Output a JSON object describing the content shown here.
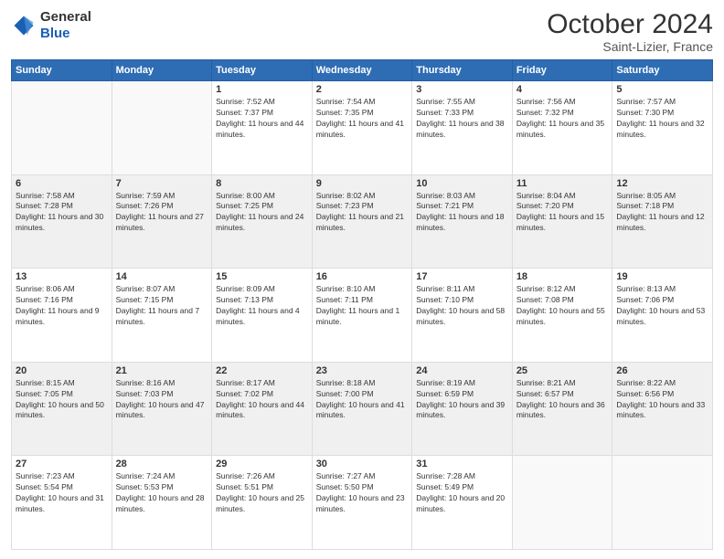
{
  "header": {
    "logo": {
      "general": "General",
      "blue": "Blue"
    },
    "month": "October 2024",
    "location": "Saint-Lizier, France"
  },
  "weekdays": [
    "Sunday",
    "Monday",
    "Tuesday",
    "Wednesday",
    "Thursday",
    "Friday",
    "Saturday"
  ],
  "weeks": [
    [
      {
        "day": "",
        "info": ""
      },
      {
        "day": "",
        "info": ""
      },
      {
        "day": "1",
        "info": "Sunrise: 7:52 AM\nSunset: 7:37 PM\nDaylight: 11 hours and 44 minutes."
      },
      {
        "day": "2",
        "info": "Sunrise: 7:54 AM\nSunset: 7:35 PM\nDaylight: 11 hours and 41 minutes."
      },
      {
        "day": "3",
        "info": "Sunrise: 7:55 AM\nSunset: 7:33 PM\nDaylight: 11 hours and 38 minutes."
      },
      {
        "day": "4",
        "info": "Sunrise: 7:56 AM\nSunset: 7:32 PM\nDaylight: 11 hours and 35 minutes."
      },
      {
        "day": "5",
        "info": "Sunrise: 7:57 AM\nSunset: 7:30 PM\nDaylight: 11 hours and 32 minutes."
      }
    ],
    [
      {
        "day": "6",
        "info": "Sunrise: 7:58 AM\nSunset: 7:28 PM\nDaylight: 11 hours and 30 minutes."
      },
      {
        "day": "7",
        "info": "Sunrise: 7:59 AM\nSunset: 7:26 PM\nDaylight: 11 hours and 27 minutes."
      },
      {
        "day": "8",
        "info": "Sunrise: 8:00 AM\nSunset: 7:25 PM\nDaylight: 11 hours and 24 minutes."
      },
      {
        "day": "9",
        "info": "Sunrise: 8:02 AM\nSunset: 7:23 PM\nDaylight: 11 hours and 21 minutes."
      },
      {
        "day": "10",
        "info": "Sunrise: 8:03 AM\nSunset: 7:21 PM\nDaylight: 11 hours and 18 minutes."
      },
      {
        "day": "11",
        "info": "Sunrise: 8:04 AM\nSunset: 7:20 PM\nDaylight: 11 hours and 15 minutes."
      },
      {
        "day": "12",
        "info": "Sunrise: 8:05 AM\nSunset: 7:18 PM\nDaylight: 11 hours and 12 minutes."
      }
    ],
    [
      {
        "day": "13",
        "info": "Sunrise: 8:06 AM\nSunset: 7:16 PM\nDaylight: 11 hours and 9 minutes."
      },
      {
        "day": "14",
        "info": "Sunrise: 8:07 AM\nSunset: 7:15 PM\nDaylight: 11 hours and 7 minutes."
      },
      {
        "day": "15",
        "info": "Sunrise: 8:09 AM\nSunset: 7:13 PM\nDaylight: 11 hours and 4 minutes."
      },
      {
        "day": "16",
        "info": "Sunrise: 8:10 AM\nSunset: 7:11 PM\nDaylight: 11 hours and 1 minute."
      },
      {
        "day": "17",
        "info": "Sunrise: 8:11 AM\nSunset: 7:10 PM\nDaylight: 10 hours and 58 minutes."
      },
      {
        "day": "18",
        "info": "Sunrise: 8:12 AM\nSunset: 7:08 PM\nDaylight: 10 hours and 55 minutes."
      },
      {
        "day": "19",
        "info": "Sunrise: 8:13 AM\nSunset: 7:06 PM\nDaylight: 10 hours and 53 minutes."
      }
    ],
    [
      {
        "day": "20",
        "info": "Sunrise: 8:15 AM\nSunset: 7:05 PM\nDaylight: 10 hours and 50 minutes."
      },
      {
        "day": "21",
        "info": "Sunrise: 8:16 AM\nSunset: 7:03 PM\nDaylight: 10 hours and 47 minutes."
      },
      {
        "day": "22",
        "info": "Sunrise: 8:17 AM\nSunset: 7:02 PM\nDaylight: 10 hours and 44 minutes."
      },
      {
        "day": "23",
        "info": "Sunrise: 8:18 AM\nSunset: 7:00 PM\nDaylight: 10 hours and 41 minutes."
      },
      {
        "day": "24",
        "info": "Sunrise: 8:19 AM\nSunset: 6:59 PM\nDaylight: 10 hours and 39 minutes."
      },
      {
        "day": "25",
        "info": "Sunrise: 8:21 AM\nSunset: 6:57 PM\nDaylight: 10 hours and 36 minutes."
      },
      {
        "day": "26",
        "info": "Sunrise: 8:22 AM\nSunset: 6:56 PM\nDaylight: 10 hours and 33 minutes."
      }
    ],
    [
      {
        "day": "27",
        "info": "Sunrise: 7:23 AM\nSunset: 5:54 PM\nDaylight: 10 hours and 31 minutes."
      },
      {
        "day": "28",
        "info": "Sunrise: 7:24 AM\nSunset: 5:53 PM\nDaylight: 10 hours and 28 minutes."
      },
      {
        "day": "29",
        "info": "Sunrise: 7:26 AM\nSunset: 5:51 PM\nDaylight: 10 hours and 25 minutes."
      },
      {
        "day": "30",
        "info": "Sunrise: 7:27 AM\nSunset: 5:50 PM\nDaylight: 10 hours and 23 minutes."
      },
      {
        "day": "31",
        "info": "Sunrise: 7:28 AM\nSunset: 5:49 PM\nDaylight: 10 hours and 20 minutes."
      },
      {
        "day": "",
        "info": ""
      },
      {
        "day": "",
        "info": ""
      }
    ]
  ]
}
